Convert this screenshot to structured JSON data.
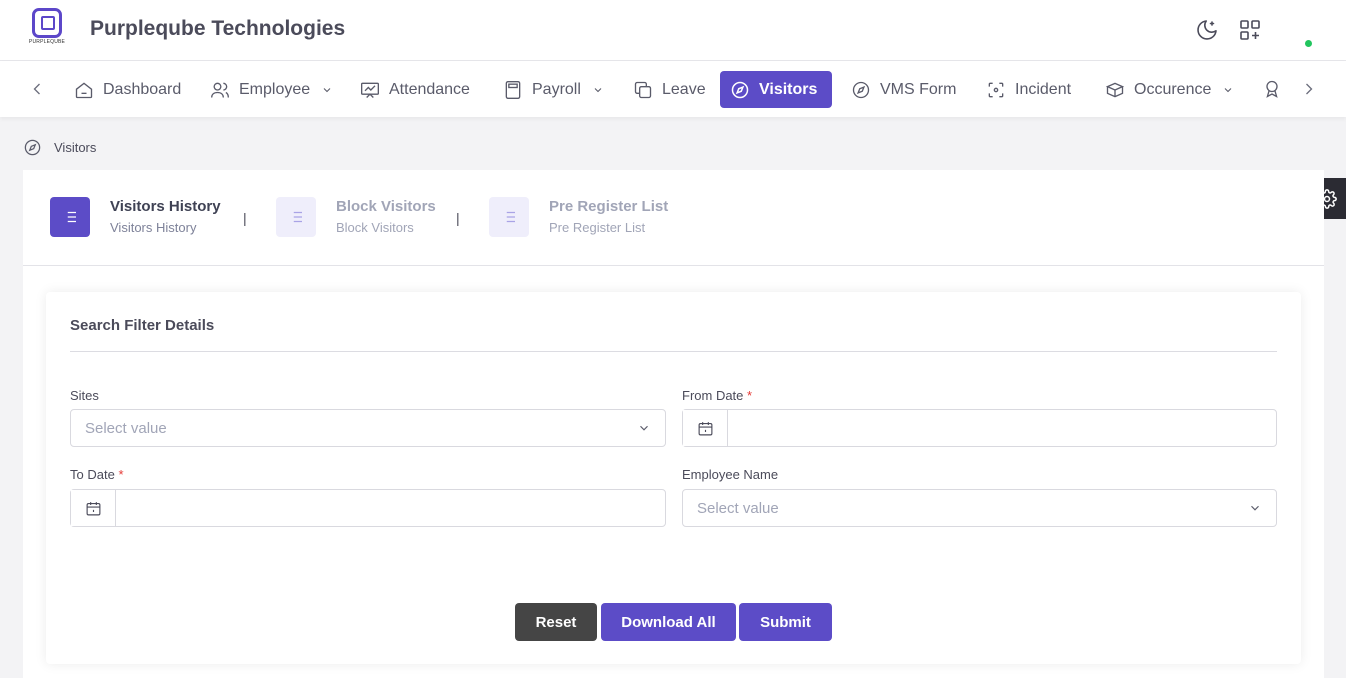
{
  "header": {
    "logo_text": "PURPLEQUBE",
    "company_name": "Purpleqube Technologies",
    "icons": [
      "moon-icon",
      "apps-add-icon"
    ],
    "status_color": "#22c55e"
  },
  "nav": {
    "items": [
      {
        "label": "Dashboard",
        "icon": "home-icon",
        "dropdown": false
      },
      {
        "label": "Employee",
        "icon": "users-icon",
        "dropdown": true
      },
      {
        "label": "Attendance",
        "icon": "presentation-chart-icon",
        "dropdown": false
      },
      {
        "label": "Payroll",
        "icon": "calculator-icon",
        "dropdown": true
      },
      {
        "label": "Leave",
        "icon": "copy-icon",
        "dropdown": false
      },
      {
        "label": "Visitors",
        "icon": "compass-icon",
        "dropdown": false,
        "active": true
      },
      {
        "label": "VMS Form",
        "icon": "compass-icon",
        "dropdown": false
      },
      {
        "label": "Incident",
        "icon": "focus-icon",
        "dropdown": false
      },
      {
        "label": "Occurence",
        "icon": "boxes-icon",
        "dropdown": true
      }
    ],
    "accent_color": "#5c4cc7"
  },
  "breadcrumb": {
    "label": "Visitors"
  },
  "tabs": [
    {
      "title": "Visitors History",
      "subtitle": "Visitors History",
      "active": true
    },
    {
      "title": "Block Visitors",
      "subtitle": "Block Visitors",
      "active": false
    },
    {
      "title": "Pre Register List",
      "subtitle": "Pre Register List",
      "active": false
    }
  ],
  "tab_separator": "|",
  "filter": {
    "title": "Search Filter Details",
    "sites": {
      "label": "Sites",
      "placeholder": "Select value"
    },
    "from_date": {
      "label": "From Date",
      "required_mark": "*",
      "value": ""
    },
    "to_date": {
      "label": "To Date",
      "required_mark": "*",
      "value": ""
    },
    "employee_name": {
      "label": "Employee Name",
      "placeholder": "Select value"
    }
  },
  "buttons": {
    "reset": "Reset",
    "download_all": "Download All",
    "submit": "Submit"
  }
}
